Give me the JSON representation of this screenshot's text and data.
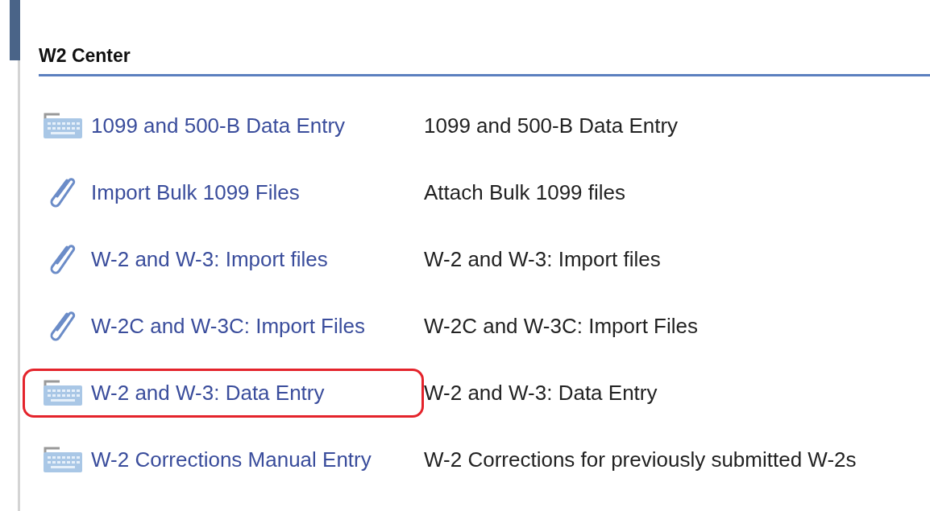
{
  "section": {
    "title": "W2 Center"
  },
  "rows": [
    {
      "kind": "keyboard",
      "link": "1099 and 500-B Data Entry",
      "description": "1099 and 500-B Data Entry",
      "highlighted": false
    },
    {
      "kind": "paperclip",
      "link": "Import Bulk 1099 Files",
      "description": "Attach Bulk 1099 files",
      "highlighted": false
    },
    {
      "kind": "paperclip",
      "link": "W-2 and W-3: Import files",
      "description": "W-2 and W-3: Import files",
      "highlighted": false
    },
    {
      "kind": "paperclip",
      "link": "W-2C and W-3C: Import Files",
      "description": "W-2C and W-3C: Import Files",
      "highlighted": false
    },
    {
      "kind": "keyboard",
      "link": "W-2 and W-3: Data Entry",
      "description": "W-2 and W-3: Data Entry",
      "highlighted": true
    },
    {
      "kind": "keyboard",
      "link": "W-2 Corrections Manual Entry",
      "description": "W-2 Corrections for previously submitted W-2s",
      "highlighted": false
    }
  ]
}
